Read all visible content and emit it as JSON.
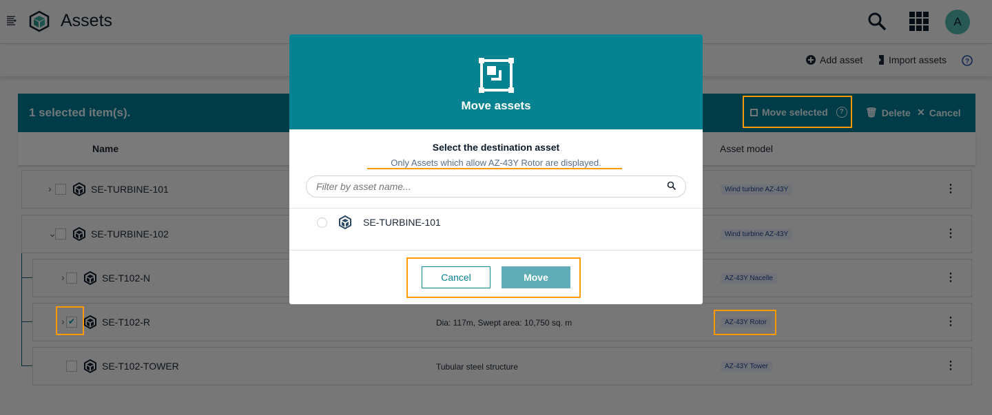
{
  "header": {
    "title": "Assets",
    "avatar_initial": "A",
    "icons": [
      "menu-icon",
      "cube-logo-icon",
      "search-icon",
      "apps-grid-icon"
    ]
  },
  "actions": {
    "add_asset": "Add asset",
    "import_assets": "Import assets"
  },
  "selection": {
    "count_text": "1 selected item(s).",
    "move_selected": "Move selected",
    "delete": "Delete",
    "cancel": "Cancel"
  },
  "table": {
    "columns": {
      "name": "Name",
      "asset_model": "Asset model"
    },
    "rows": [
      {
        "name": "SE-TURBINE-101",
        "description": "",
        "model": "Wind turbine AZ-43Y",
        "checked": false,
        "expanded": false
      },
      {
        "name": "SE-TURBINE-102",
        "description": "",
        "model": "Wind turbine AZ-43Y",
        "checked": false,
        "expanded": true
      },
      {
        "name": "SE-T102-N",
        "description": "",
        "model": "AZ-43Y Nacelle",
        "checked": false,
        "expanded": false
      },
      {
        "name": "SE-T102-R",
        "description": "Dia: 117m, Swept area: 10,750 sq. m",
        "model": "AZ-43Y Rotor",
        "checked": true,
        "expanded": false
      },
      {
        "name": "SE-T102-TOWER",
        "description": "Tubular steel structure",
        "model": "AZ-43Y Tower",
        "checked": false
      }
    ]
  },
  "modal": {
    "title": "Move assets",
    "heading": "Select the destination asset",
    "subheading": "Only Assets which allow AZ-43Y Rotor are displayed.",
    "filter_placeholder": "Filter by asset name...",
    "options": [
      {
        "name": "SE-TURBINE-101",
        "selected": false
      }
    ],
    "cancel": "Cancel",
    "move": "Move"
  },
  "colors": {
    "teal": "#078290",
    "highlight": "#ff9900",
    "tag_text": "#1f3f8f"
  }
}
